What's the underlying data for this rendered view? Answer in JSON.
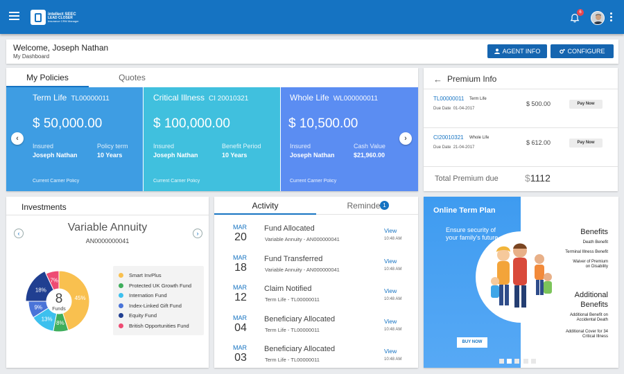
{
  "header": {
    "logo_line1": "intellect SEEC",
    "logo_line2": "LEAD CLOSER",
    "logo_line3": "Insurance CRM Manager",
    "notification_count": "6"
  },
  "welcome": {
    "greeting": "Welcome, Joseph Nathan",
    "subtitle": "My Dashboard",
    "agent_info_label": "AGENT INFO",
    "configure_label": "CONFIGURE"
  },
  "policies": {
    "tabs": [
      "My Policies",
      "Quotes"
    ],
    "cards": [
      {
        "name": "Term Life",
        "id": "TL00000011",
        "amount": "$ 50,000.00",
        "label1": "Insured",
        "value1": "Joseph Nathan",
        "label2": "Policy term",
        "value2": "10 Years",
        "carrier": "Current Carrier Policy",
        "color": "#3e9de3"
      },
      {
        "name": "Critical Illness",
        "id": "CI 20010321",
        "amount": "$ 100,000.00",
        "label1": "Insured",
        "value1": "Joseph Nathan",
        "label2": "Benefit Period",
        "value2": "10 Years",
        "carrier": "Current Carrier Policy",
        "color": "#40c0de"
      },
      {
        "name": "Whole Life",
        "id": "WL000000011",
        "amount": "$ 10,500.00",
        "label1": "Insured",
        "value1": "Joseph Nathan",
        "label2": "Cash Value",
        "value2": "$21,960.00",
        "carrier": "Current Carrier Policy",
        "color": "#5b8df2"
      }
    ]
  },
  "premium": {
    "title": "Premium Info",
    "rows": [
      {
        "id": "TL00000011",
        "type": "Term Life",
        "due_label": "Due Date",
        "due": "01-04-2017",
        "amount": "$ 500.00",
        "pay": "Pay Now"
      },
      {
        "id": "CI20010321",
        "type": "Whole Life",
        "due_label": "Due Date",
        "due": "21-04-2017",
        "amount": "$ 612.00",
        "pay": "Pay Now"
      }
    ],
    "total_label": "Total Premium due",
    "total_currency": "$",
    "total_value": "1112"
  },
  "investments": {
    "title": "Investments",
    "fund_name": "Variable Annuity",
    "fund_id": "AN0000000041",
    "center_value": "8",
    "center_label": "Funds",
    "funds": [
      {
        "name": "Smart InvPlus",
        "percent": 45,
        "label": "45%",
        "color": "#f9c04f"
      },
      {
        "name": "Protected UK Growth Fund",
        "percent": 8,
        "label": "8%",
        "color": "#3fae5c"
      },
      {
        "name": "Internation Fund",
        "percent": 13,
        "label": "13%",
        "color": "#3dc0ee"
      },
      {
        "name": "Index-Linked  Gift Fund",
        "percent": 9,
        "label": "9%",
        "color": "#4a74d8"
      },
      {
        "name": "Equity Fund",
        "percent": 18,
        "label": "18%",
        "color": "#203f91"
      },
      {
        "name": "British Opportunities Fund",
        "percent": 7,
        "label": "7%",
        "color": "#ee4b73"
      }
    ]
  },
  "activity": {
    "tabs": [
      "Activity",
      "Reminders"
    ],
    "reminders_badge": "1",
    "view_label": "View",
    "items": [
      {
        "month": "MAR",
        "day": "20",
        "title": "Fund Allocated",
        "sub": "Variable Annuity - AN000000041",
        "time": "10:48 AM"
      },
      {
        "month": "MAR",
        "day": "18",
        "title": "Fund Transferred",
        "sub": "Variable Annuity - AN000000041",
        "time": "10:48 AM"
      },
      {
        "month": "MAR",
        "day": "12",
        "title": "Claim Notified",
        "sub": "Term Life - TL00000011",
        "time": "10:48 AM"
      },
      {
        "month": "MAR",
        "day": "04",
        "title": "Beneficiary Allocated",
        "sub": "Term Life - TL00000011",
        "time": "10:48 AM"
      },
      {
        "month": "MAR",
        "day": "03",
        "title": "Beneficiary Allocated",
        "sub": "Term Life - TL00000011",
        "time": "10:48 AM"
      }
    ]
  },
  "promo": {
    "title": "Online Term Plan",
    "subtitle": "Ensure security of your family's future.",
    "buy_label": "BUY NOW",
    "benefits_title": "Benefits",
    "benefits": [
      "Death Benefit",
      "Terminal Illness Benefit",
      "Waiver of Premium",
      "on Disability"
    ],
    "additional_title_1": "Additional",
    "additional_title_2": "Benefits",
    "additional": [
      "Additional Benefit on",
      "Accidental Death",
      "Additional Cover for 34",
      "Critical Illness"
    ]
  }
}
